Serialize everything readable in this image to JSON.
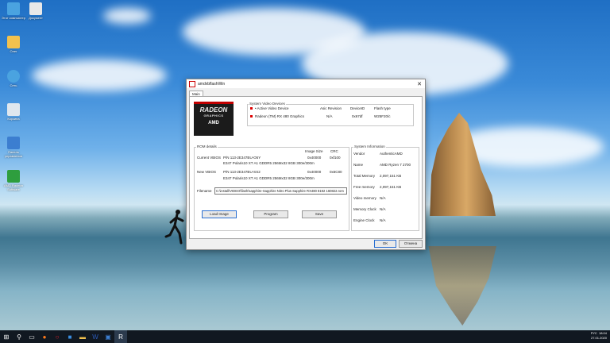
{
  "desktop": {
    "icons": [
      {
        "label": "Этот компьютер",
        "icon": "computer-icon",
        "color": "#4aa3e0"
      },
      {
        "label": "Документ",
        "icon": "document-icon",
        "color": "#e8e8e8"
      },
      {
        "label": "Олег",
        "icon": "user-folder-icon",
        "color": "#f2c14e"
      },
      {
        "label": "Сеть",
        "icon": "network-icon",
        "color": "#4aa3e0"
      },
      {
        "label": "Корзина",
        "icon": "recycle-bin-icon",
        "color": "#dfe7ee"
      },
      {
        "label": "Панель управления",
        "icon": "control-panel-icon",
        "color": "#3c7ed0"
      },
      {
        "label": "AMD Radeon Software",
        "icon": "radeon-icon",
        "color": "#2e9e3e"
      }
    ]
  },
  "window": {
    "title": "amdvbflashWin",
    "tab": "Main",
    "logo": {
      "line1": "RADEON",
      "line2": "GRAPHICS",
      "line3": "AMD"
    },
    "devices": {
      "group_label": "System Video Devices",
      "header": {
        "device": "• Active Video Device",
        "asic": "Asic Revision",
        "device_id": "DeviceID",
        "flash": "Flash type"
      },
      "row": {
        "device": "Radeon (TM) RX 480 Graphics",
        "asic": "N/A",
        "device_id": "0x67df",
        "flash": "W25F20/c"
      }
    },
    "rom": {
      "group_label": "ROM details",
      "col_image_size": "Image Size",
      "col_crc": "CRC",
      "current_label": "Current VBIOS",
      "current_pn": "P/N   113-2E347BU-O5Y",
      "current_desc": "E347 Polaris10 XT A1 GDDR5 256Mx32 8GB 300e/300m",
      "current_size": "0x40000",
      "current_crc": "0xf100",
      "new_label": "New VBIOS",
      "new_pn": "P/N   113-2E347BU-SS2",
      "new_desc": "E347 Polaris10 XT A1 GDDR5 256Mx32 8GB 300e/300m",
      "new_size": "0x40000",
      "new_crc": "0x6C80",
      "filename_label": "Filename",
      "filename_value": "C:\\install\\VIDEO\\flash\\sapphire-Sapphire Nitro Plus Sapphire RX480 8192 160822.rom"
    },
    "sysinfo": {
      "group_label": "System Information",
      "rows": [
        {
          "k": "Vendor",
          "v": "AuthenticAMD"
        },
        {
          "k": "Name",
          "v": "AMD Ryzen 7 2700"
        },
        {
          "k": "Total Memory",
          "v": "2,097,151 KB"
        },
        {
          "k": "Free memory",
          "v": "2,097,151 KB"
        },
        {
          "k": "Video memory",
          "v": "N/A"
        },
        {
          "k": "Memory Clock",
          "v": "N/A"
        },
        {
          "k": "Engine Clock",
          "v": "N/A"
        }
      ]
    },
    "buttons": {
      "load": "Load Image",
      "program": "Program",
      "save": "Save",
      "ok": "OK",
      "cancel": "Отмена"
    }
  },
  "taskbar": {
    "time": "18:04",
    "date": "27.01.2020",
    "lang": "РУС"
  }
}
